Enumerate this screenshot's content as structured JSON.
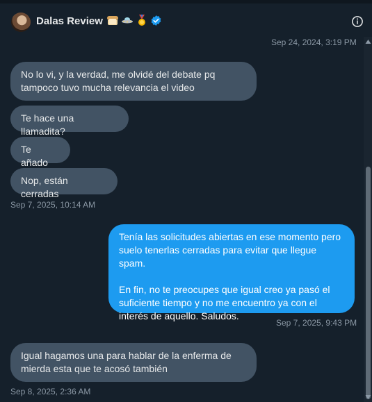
{
  "header": {
    "name": "Dalas Review",
    "emojis": [
      "bread-emoji",
      "ufo-emoji",
      "medal-emoji"
    ],
    "verified": true
  },
  "messages": {
    "ts0": "Sep 24, 2024, 3:19 PM",
    "m1": "No lo vi, y la verdad, me olvidé del debate pq tampoco tuvo mucha relevancia el video",
    "m2": "Te hace una llamadita?",
    "m3": "Te añado",
    "m4": "Nop, están cerradas",
    "ts1": "Sep 7, 2025, 10:14 AM",
    "m5p1": "Tenía las solicitudes abiertas en ese momento pero suelo tenerlas cerradas para evitar que llegue spam.",
    "m5p2": "En fin, no te preocupes que igual creo ya pasó el suficiente tiempo y no me encuentro ya con el interés de aquello. Saludos.",
    "ts2": "Sep 7, 2025, 9:43 PM",
    "m6": "Igual hagamos una para hablar de la enferma de mierda esta que te acosó también",
    "ts3": "Sep 8, 2025, 2:36 AM"
  },
  "colors": {
    "background": "#15202b",
    "incoming_bubble": "#425364",
    "outgoing_bubble": "#1d9bf0",
    "verified": "#1d9bf0"
  }
}
